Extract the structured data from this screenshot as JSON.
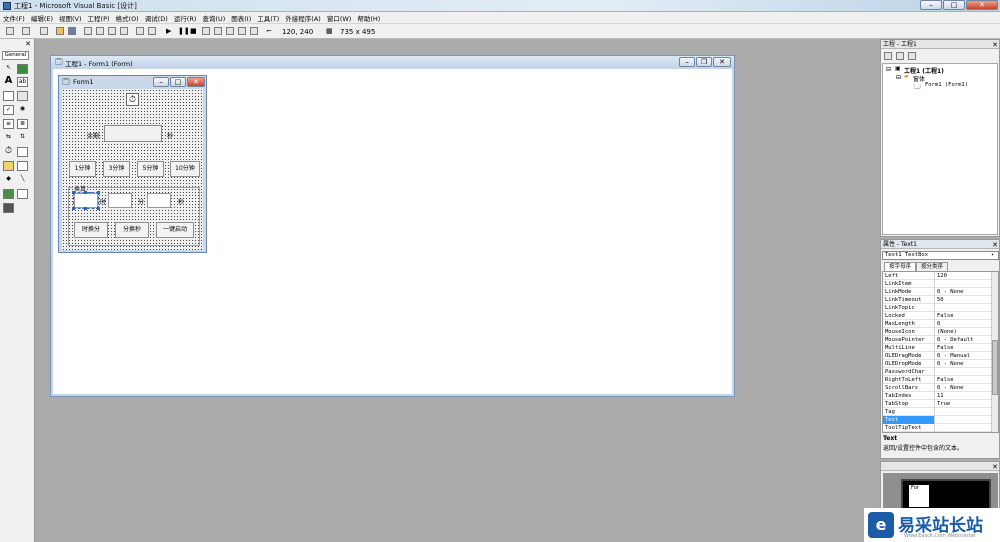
{
  "window": {
    "title": "工程1 - Microsoft Visual Basic [设计]"
  },
  "menu": [
    "文件(F)",
    "编辑(E)",
    "视图(V)",
    "工程(P)",
    "格式(O)",
    "调试(D)",
    "运行(R)",
    "查询(U)",
    "图表(I)",
    "工具(T)",
    "外接程序(A)",
    "窗口(W)",
    "帮助(H)"
  ],
  "toolbar": {
    "position": "120, 240",
    "size": "735 x 495"
  },
  "toolbox": {
    "title": "General"
  },
  "form_window": {
    "title": "工程1 - Form1 (Form)"
  },
  "form1": {
    "title": "Form1",
    "remaining_label": "余剩:",
    "seconds_unit": "秒",
    "buttons_minutes": [
      "1分钟",
      "3分钟",
      "5分钟",
      "10分钟"
    ],
    "convert_frame": "换算",
    "hour_label": "时",
    "minute_label": "分",
    "second_label": "秒",
    "buttons_convert": [
      "时换分",
      "分换秒",
      "一键启动"
    ]
  },
  "project": {
    "title": "工程 - 工程1",
    "root": "工程1 (工程1)",
    "folder": "窗体",
    "item": "Form1 (Form1)"
  },
  "properties": {
    "title": "属性 - Text1",
    "object": "Text1 TextBox",
    "tabs": [
      "按字母序",
      "按分类序"
    ],
    "rows": [
      {
        "name": "Left",
        "value": "120"
      },
      {
        "name": "LinkItem",
        "value": ""
      },
      {
        "name": "LinkMode",
        "value": "0 - None"
      },
      {
        "name": "LinkTimeout",
        "value": "50"
      },
      {
        "name": "LinkTopic",
        "value": ""
      },
      {
        "name": "Locked",
        "value": "False"
      },
      {
        "name": "MaxLength",
        "value": "0"
      },
      {
        "name": "MouseIcon",
        "value": "(None)"
      },
      {
        "name": "MousePointer",
        "value": "0 - Default"
      },
      {
        "name": "MultiLine",
        "value": "False"
      },
      {
        "name": "OLEDragMode",
        "value": "0 - Manual"
      },
      {
        "name": "OLEDropMode",
        "value": "0 - None"
      },
      {
        "name": "PasswordChar",
        "value": ""
      },
      {
        "name": "RightToLeft",
        "value": "False"
      },
      {
        "name": "ScrollBars",
        "value": "0 - None"
      },
      {
        "name": "TabIndex",
        "value": "11"
      },
      {
        "name": "TabStop",
        "value": "True"
      },
      {
        "name": "Tag",
        "value": ""
      },
      {
        "name": "Text",
        "value": ""
      },
      {
        "name": "ToolTipText",
        "value": ""
      }
    ],
    "desc_title": "Text",
    "desc_text": "返回/设置控件中包含的文本。"
  },
  "layout_panel": {
    "preview_label": "For"
  },
  "watermark": {
    "brand": "易采站长站",
    "sub": "Www.Easck.Com Webmaster"
  }
}
